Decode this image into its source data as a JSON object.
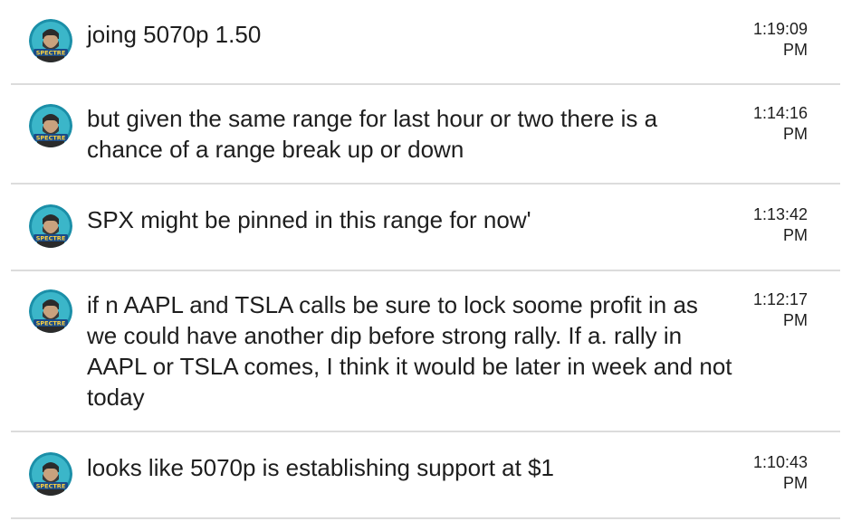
{
  "avatar": {
    "icon": "spectre-bearded-man-avatar-icon",
    "label": "SPECTRE",
    "colors": {
      "ring": "#1b8fa8",
      "bg": "#3bb6c9",
      "head": "#2b2b2b",
      "label_bg": "#1a4c8a",
      "label_text": "#ffd23f"
    }
  },
  "messages": [
    {
      "text": "joing 5070p 1.50",
      "time": "1:19:09",
      "ampm": "PM"
    },
    {
      "text": "but given the same range for last hour or two there is a chance of a range break up or down",
      "time": "1:14:16",
      "ampm": "PM"
    },
    {
      "text": "SPX might be pinned in this range for now'",
      "time": "1:13:42",
      "ampm": "PM"
    },
    {
      "text": "if n AAPL and TSLA calls be sure to lock soome profit in as we could have another dip before strong rally. If a. rally in AAPL or TSLA comes, I think it would be later in week and not today",
      "time": "1:12:17",
      "ampm": "PM"
    },
    {
      "text": "looks like 5070p is establishing support at $1",
      "time": "1:10:43",
      "ampm": "PM"
    }
  ]
}
